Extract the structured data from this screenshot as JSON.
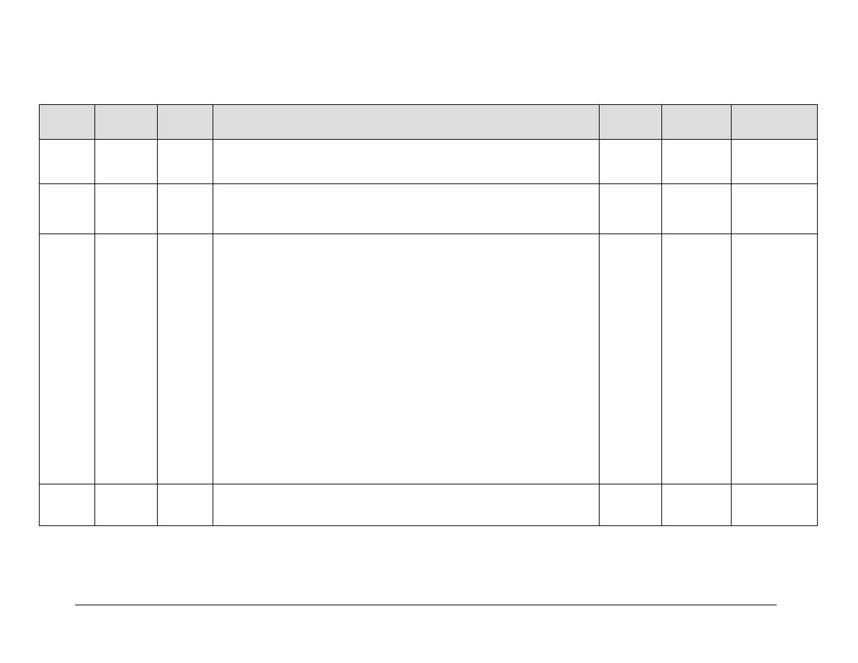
{
  "table": {
    "headers": [
      "",
      "",
      "",
      "",
      "",
      "",
      ""
    ],
    "rows": [
      [
        "",
        "",
        "",
        "",
        "",
        "",
        ""
      ],
      [
        "",
        "",
        "",
        "",
        "",
        "",
        ""
      ],
      [
        "",
        "",
        "",
        "",
        "",
        "",
        ""
      ],
      [
        "",
        "",
        "",
        "",
        "",
        "",
        ""
      ]
    ]
  }
}
